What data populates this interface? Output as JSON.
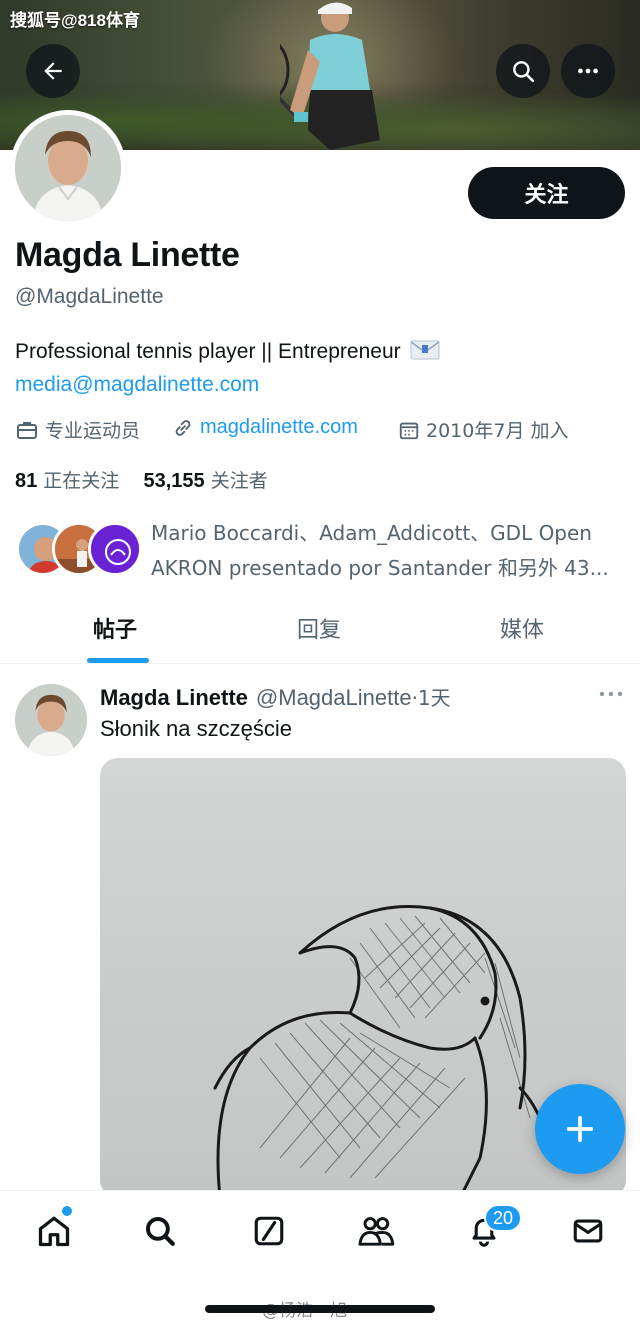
{
  "watermark_top": "搜狐号@818体育",
  "watermark_bottom": "@杨浩一旭",
  "profile": {
    "follow_label": "关注",
    "name": "Magda Linette",
    "handle": "@MagdaLinette",
    "bio": "Professional tennis player || Entrepreneur",
    "bio_email": "media@magdalinette.com",
    "category": "专业运动员",
    "website": "magdalinette.com",
    "joined": "2010年7月 加入",
    "following_count": "81",
    "following_label": "正在关注",
    "followers_count": "53,155",
    "followers_label": "关注者",
    "followed_by": "Mario Boccardi、Adam_Addicott、GDL Open AKRON presentado por Santander 和另外 43..."
  },
  "tabs": [
    {
      "label": "帖子",
      "active": true
    },
    {
      "label": "回复",
      "active": false
    },
    {
      "label": "媒体",
      "active": false
    }
  ],
  "post": {
    "author": "Magda Linette",
    "handle": "@MagdaLinette",
    "time": "·1天",
    "text": "Słonik na szczęście"
  },
  "nav": {
    "notifications_badge": "20"
  },
  "icons": [
    "back-arrow-icon",
    "search-icon",
    "more-icon",
    "briefcase-icon",
    "link-icon",
    "calendar-icon",
    "home-icon",
    "explore-icon",
    "grok-icon",
    "communities-icon",
    "notifications-icon",
    "messages-icon",
    "compose-icon"
  ],
  "colors": {
    "accent": "#1d9bf0",
    "text": "#0f1419",
    "muted": "#536471"
  }
}
